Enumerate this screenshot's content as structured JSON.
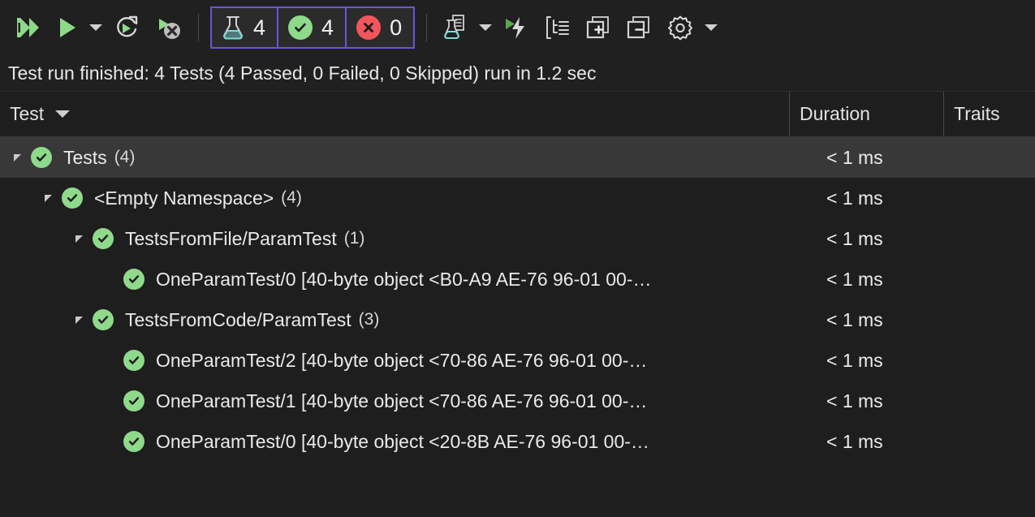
{
  "toolbar": {
    "buttons": [
      {
        "name": "run-all-tests-button",
        "icon": "run-all-icon",
        "tooltip": "Run All Tests"
      },
      {
        "name": "run-button",
        "icon": "run-icon",
        "tooltip": "Run"
      },
      {
        "name": "run-dropdown-button",
        "icon": "chevron-down-icon",
        "tooltip": "Run Options"
      },
      {
        "name": "repeat-last-run-button",
        "icon": "repeat-run-icon",
        "tooltip": "Repeat Last Run"
      },
      {
        "name": "cancel-run-button",
        "icon": "cancel-run-icon",
        "tooltip": "Cancel Test Run"
      }
    ],
    "counters": [
      {
        "name": "total-tests-counter",
        "icon": "flask-icon",
        "value": "4"
      },
      {
        "name": "passed-tests-counter",
        "icon": "check-circle-icon",
        "value": "4"
      },
      {
        "name": "failed-tests-counter",
        "icon": "error-circle-icon",
        "value": "0"
      }
    ],
    "right_buttons": [
      {
        "name": "test-detail-summary-button",
        "icon": "test-document-icon",
        "tooltip": "Test Detail Summary"
      },
      {
        "name": "test-detail-dropdown-button",
        "icon": "chevron-down-icon",
        "tooltip": "More Options"
      },
      {
        "name": "run-until-failure-button",
        "icon": "run-lightning-icon",
        "tooltip": "Run Until Failure"
      },
      {
        "name": "group-by-button",
        "icon": "group-by-icon",
        "tooltip": "Group By"
      },
      {
        "name": "expand-all-button",
        "icon": "expand-all-icon",
        "tooltip": "Expand All"
      },
      {
        "name": "collapse-all-button",
        "icon": "collapse-all-icon",
        "tooltip": "Collapse All"
      },
      {
        "name": "settings-button",
        "icon": "gear-icon",
        "tooltip": "Settings"
      },
      {
        "name": "settings-dropdown-button",
        "icon": "chevron-down-icon",
        "tooltip": "Settings Options"
      }
    ],
    "accent_border": "#6d53e0"
  },
  "status": {
    "text": "Test run finished: 4 Tests (4 Passed, 0 Failed, 0 Skipped) run in 1.2 sec"
  },
  "grid": {
    "columns": {
      "test": "Test",
      "duration": "Duration",
      "traits": "Traits"
    },
    "rows": [
      {
        "indent": 0,
        "expander": "expanded",
        "status": "passed",
        "label": "Tests",
        "count": "(4)",
        "duration": "< 1 ms",
        "traits": "",
        "hover": true
      },
      {
        "indent": 1,
        "expander": "expanded",
        "status": "passed",
        "label": "<Empty Namespace>",
        "count": "(4)",
        "duration": "< 1 ms",
        "traits": "",
        "hover": false
      },
      {
        "indent": 2,
        "expander": "expanded",
        "status": "passed",
        "label": "TestsFromFile/ParamTest",
        "count": "(1)",
        "duration": "< 1 ms",
        "traits": "",
        "hover": false
      },
      {
        "indent": 3,
        "expander": "none",
        "status": "passed",
        "label": "OneParamTest/0 [40-byte object <B0-A9 AE-76 96-01 00-…",
        "count": "",
        "duration": "< 1 ms",
        "traits": "",
        "hover": false
      },
      {
        "indent": 2,
        "expander": "expanded",
        "status": "passed",
        "label": "TestsFromCode/ParamTest",
        "count": "(3)",
        "duration": "< 1 ms",
        "traits": "",
        "hover": false
      },
      {
        "indent": 3,
        "expander": "none",
        "status": "passed",
        "label": "OneParamTest/2 [40-byte object <70-86 AE-76 96-01 00-…",
        "count": "",
        "duration": "< 1 ms",
        "traits": "",
        "hover": false
      },
      {
        "indent": 3,
        "expander": "none",
        "status": "passed",
        "label": "OneParamTest/1 [40-byte object <70-86 AE-76 96-01 00-…",
        "count": "",
        "duration": "< 1 ms",
        "traits": "",
        "hover": false
      },
      {
        "indent": 3,
        "expander": "none",
        "status": "passed",
        "label": "OneParamTest/0 [40-byte object <20-8B AE-76 96-01 00-…",
        "count": "",
        "duration": "< 1 ms",
        "traits": "",
        "hover": false
      }
    ]
  },
  "colors": {
    "background": "#1e1e1e",
    "toolbar_background": "#202020",
    "hover_row": "#383838",
    "pass_green": "#8fd98b",
    "fail_red": "#f2565c",
    "accent_purple": "#6d53e0",
    "flask_teal": "#7fdbd6"
  }
}
